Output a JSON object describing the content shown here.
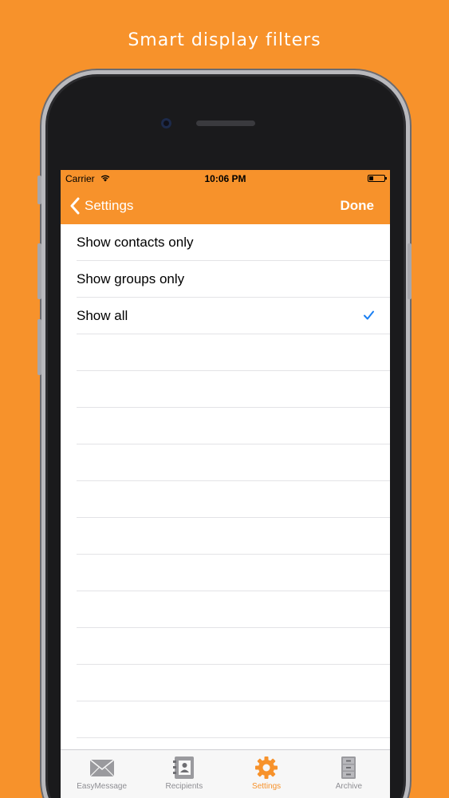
{
  "headline": "Smart display filters",
  "statusbar": {
    "carrier": "Carrier",
    "time": "10:06 PM"
  },
  "navbar": {
    "back_label": "Settings",
    "done_label": "Done"
  },
  "options": [
    {
      "label": "Show contacts only",
      "selected": false
    },
    {
      "label": "Show groups only",
      "selected": false
    },
    {
      "label": "Show all",
      "selected": true
    }
  ],
  "tabs": [
    {
      "label": "EasyMessage",
      "icon": "envelope-icon",
      "active": false
    },
    {
      "label": "Recipients",
      "icon": "address-book-icon",
      "active": false
    },
    {
      "label": "Settings",
      "icon": "gear-icon",
      "active": true
    },
    {
      "label": "Archive",
      "icon": "cabinet-icon",
      "active": false
    }
  ],
  "colors": {
    "accent": "#f7922b",
    "checkmark": "#1a7ff2",
    "tab_inactive": "#8e8e93"
  }
}
